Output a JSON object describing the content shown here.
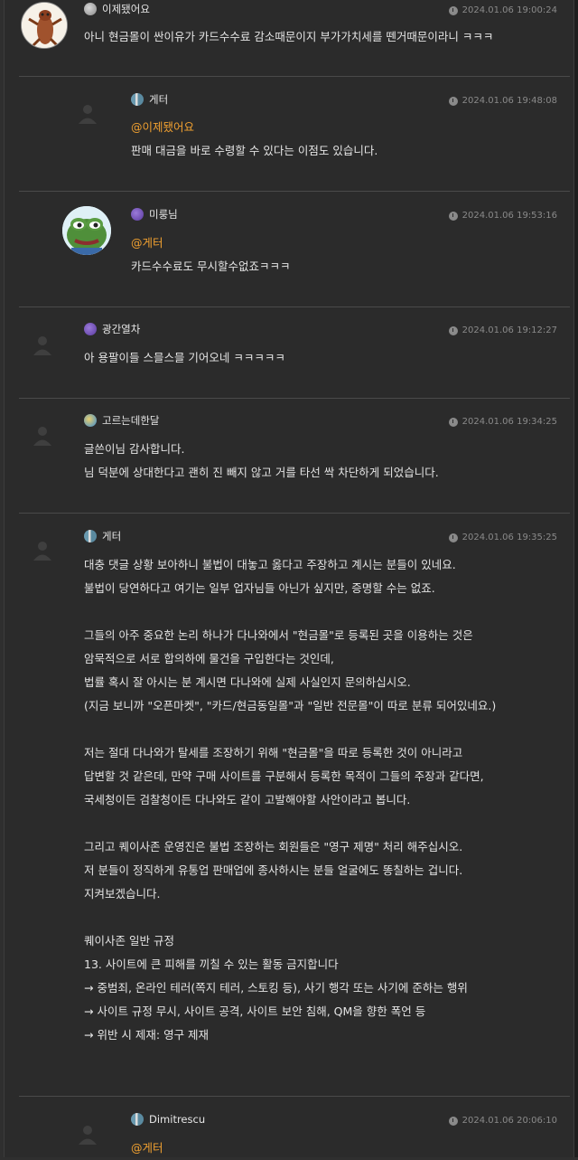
{
  "comments": [
    {
      "nickname": "이제됐어요",
      "date": "2024.01.06 19:00:24",
      "lines": [
        "아니 현금몰이 싼이유가 카드수수료 감소때문이지 부가가치세를 뗀거때문이라니 ㅋㅋㅋ"
      ]
    },
    {
      "nickname": "게터",
      "date": "2024.01.06 19:48:08",
      "mention": "@이제됐어요",
      "lines": [
        "판매 대금을 바로 수령할 수 있다는 이점도 있습니다."
      ]
    },
    {
      "nickname": "미룽님",
      "date": "2024.01.06 19:53:16",
      "mention": "@게터",
      "lines": [
        "카드수수료도 무시할수없죠ㅋㅋㅋ"
      ]
    },
    {
      "nickname": "광간열차",
      "date": "2024.01.06 19:12:27",
      "lines": [
        "아 용팔이들 스믈스믈 기어오네 ㅋㅋㅋㅋㅋ"
      ]
    },
    {
      "nickname": "고르는데한달",
      "date": "2024.01.06 19:34:25",
      "lines": [
        "글쓴이님 감사합니다.",
        "님 덕분에 상대한다고 괜히 진 빼지 않고 거를 타선 싹 차단하게 되었습니다."
      ]
    },
    {
      "nickname": "게터",
      "date": "2024.01.06 19:35:25",
      "lines": [
        "대충 댓글 상황 보아하니 불법이 대놓고 옳다고 주장하고 계시는 분들이 있네요.",
        "불법이 당연하다고 여기는 일부 업자님들 아닌가 싶지만, 증명할 수는 없죠.",
        "",
        "그들의 아주 중요한 논리 하나가 다나와에서 \"현금몰\"로 등록된 곳을 이용하는 것은",
        "암묵적으로 서로 합의하에 물건을 구입한다는 것인데,",
        "법률 혹시 잘 아시는 분 계시면 다나와에 실제 사실인지 문의하십시오.",
        "(지금 보니까 \"오픈마켓\", \"카드/현금동일몰\"과 \"일반 전문몰\"이 따로 분류 되어있네요.)",
        "",
        "저는 절대 다나와가 탈세를 조장하기 위해 \"현금몰\"을 따로 등록한 것이 아니라고",
        "답변할 것 같은데, 만약 구매 사이트를 구분해서 등록한 목적이 그들의 주장과 같다면,",
        "국세청이든 검찰청이든 다나와도 같이 고발해야할 사안이라고 봅니다.",
        "",
        "그리고 퀘이사존 운영진은 불법 조장하는 회원들은 \"영구 제명\" 처리 해주십시오.",
        "저 분들이 정직하게 유통업 판매업에 종사하시는 분들 얼굴에도 똥칠하는 겁니다.",
        "지켜보겠습니다.",
        "",
        "퀘이사존 일반 규정",
        "13. 사이트에 큰 피해를 끼칠 수 있는 활동 금지합니다",
        "→ 중범죄, 온라인 테러(쪽지 테러, 스토킹 등), 사기 행각 또는 사기에 준하는 행위",
        "→ 사이트 규정 무시, 사이트 공격, 사이트 보안 침해, QM을 향한 폭언 등",
        "→ 위반 시 제재: 영구 제재"
      ]
    },
    {
      "nickname": "Dimitrescu",
      "date": "2024.01.06 20:06:10",
      "mention": "@게터",
      "lines": []
    }
  ],
  "colors": {
    "mention": "#f0a030",
    "background": "#2b2b2b",
    "separator": "#4a4a4a"
  }
}
